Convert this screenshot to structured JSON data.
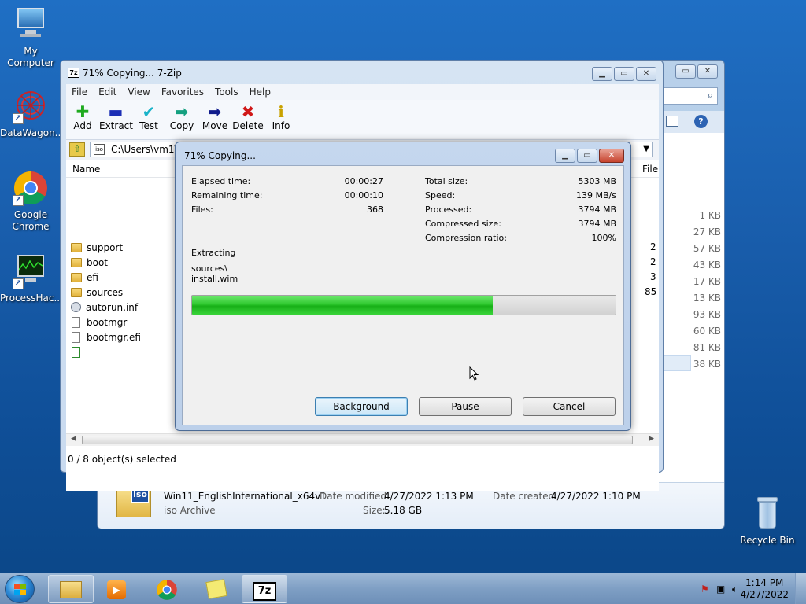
{
  "desktop": {
    "icons": [
      {
        "label": "My Computer"
      },
      {
        "label": "DataWagon..."
      },
      {
        "label": "Google Chrome"
      },
      {
        "label": "ProcessHac..."
      },
      {
        "label": "Recycle Bin"
      }
    ]
  },
  "explorer": {
    "sizes": [
      "1 KB",
      "27 KB",
      "57 KB",
      "43 KB",
      "17 KB",
      "13 KB",
      "93 KB",
      "60 KB",
      "81 KB",
      "38 KB"
    ],
    "details": {
      "name": "Win11_EnglishInternational_x64v1",
      "type": "iso Archive",
      "modified_label": "Date modified:",
      "modified": "4/27/2022 1:13 PM",
      "created_label": "Date created:",
      "created": "4/27/2022 1:10 PM",
      "size_label": "Size:",
      "size": "5.18 GB",
      "icon_text": "iso"
    }
  },
  "zip": {
    "title": "71% Copying... 7-Zip",
    "logo": "7z",
    "menu": [
      "File",
      "Edit",
      "View",
      "Favorites",
      "Tools",
      "Help"
    ],
    "toolbar": [
      {
        "label": "Add",
        "glyph": "✚",
        "color": "#1faa1f"
      },
      {
        "label": "Extract",
        "glyph": "▬",
        "color": "#1c2fb5"
      },
      {
        "label": "Test",
        "glyph": "✔",
        "color": "#1ab3c9"
      },
      {
        "label": "Copy",
        "glyph": "➡",
        "color": "#14a080"
      },
      {
        "label": "Move",
        "glyph": "➡",
        "color": "#101b8c"
      },
      {
        "label": "Delete",
        "glyph": "✖",
        "color": "#d01818"
      },
      {
        "label": "Info",
        "glyph": "i",
        "color": "#c9a200"
      }
    ],
    "address": "C:\\Users\\vm1\\D",
    "columns": {
      "name": "Name",
      "file": "File"
    },
    "rows": [
      {
        "name": "support",
        "type": "folder",
        "count": "2"
      },
      {
        "name": "boot",
        "type": "folder",
        "count": "2"
      },
      {
        "name": "efi",
        "type": "folder",
        "count": "3"
      },
      {
        "name": "sources",
        "type": "folder",
        "count": "85"
      },
      {
        "name": "autorun.inf",
        "type": "gear",
        "count": ""
      },
      {
        "name": "bootmgr",
        "type": "file",
        "count": ""
      },
      {
        "name": "bootmgr.efi",
        "type": "file",
        "count": ""
      },
      {
        "name": "",
        "type": "file",
        "count": ""
      }
    ],
    "status": "0 / 8 object(s) selected"
  },
  "progress_dialog": {
    "title": "71% Copying...",
    "left_stats": [
      {
        "label": "Elapsed time:",
        "value": "00:00:27"
      },
      {
        "label": "Remaining time:",
        "value": "00:00:10"
      },
      {
        "label": "Files:",
        "value": "368"
      }
    ],
    "right_stats": [
      {
        "label": "Total size:",
        "value": "5303 MB"
      },
      {
        "label": "Speed:",
        "value": "139 MB/s"
      },
      {
        "label": "Processed:",
        "value": "3794 MB"
      },
      {
        "label": "Compressed size:",
        "value": "3794 MB"
      },
      {
        "label": "Compression ratio:",
        "value": "100%"
      }
    ],
    "operation": "Extracting",
    "path_line1": "sources\\",
    "path_line2": "install.wim",
    "progress_fraction": 0.71,
    "buttons": {
      "background": "Background",
      "pause": "Pause",
      "cancel": "Cancel"
    }
  },
  "taskbar": {
    "time": "1:14 PM",
    "date": "4/27/2022",
    "zip_label": "7z"
  },
  "colors": {
    "progress": "#22c022",
    "accent": "#1a5fae"
  }
}
